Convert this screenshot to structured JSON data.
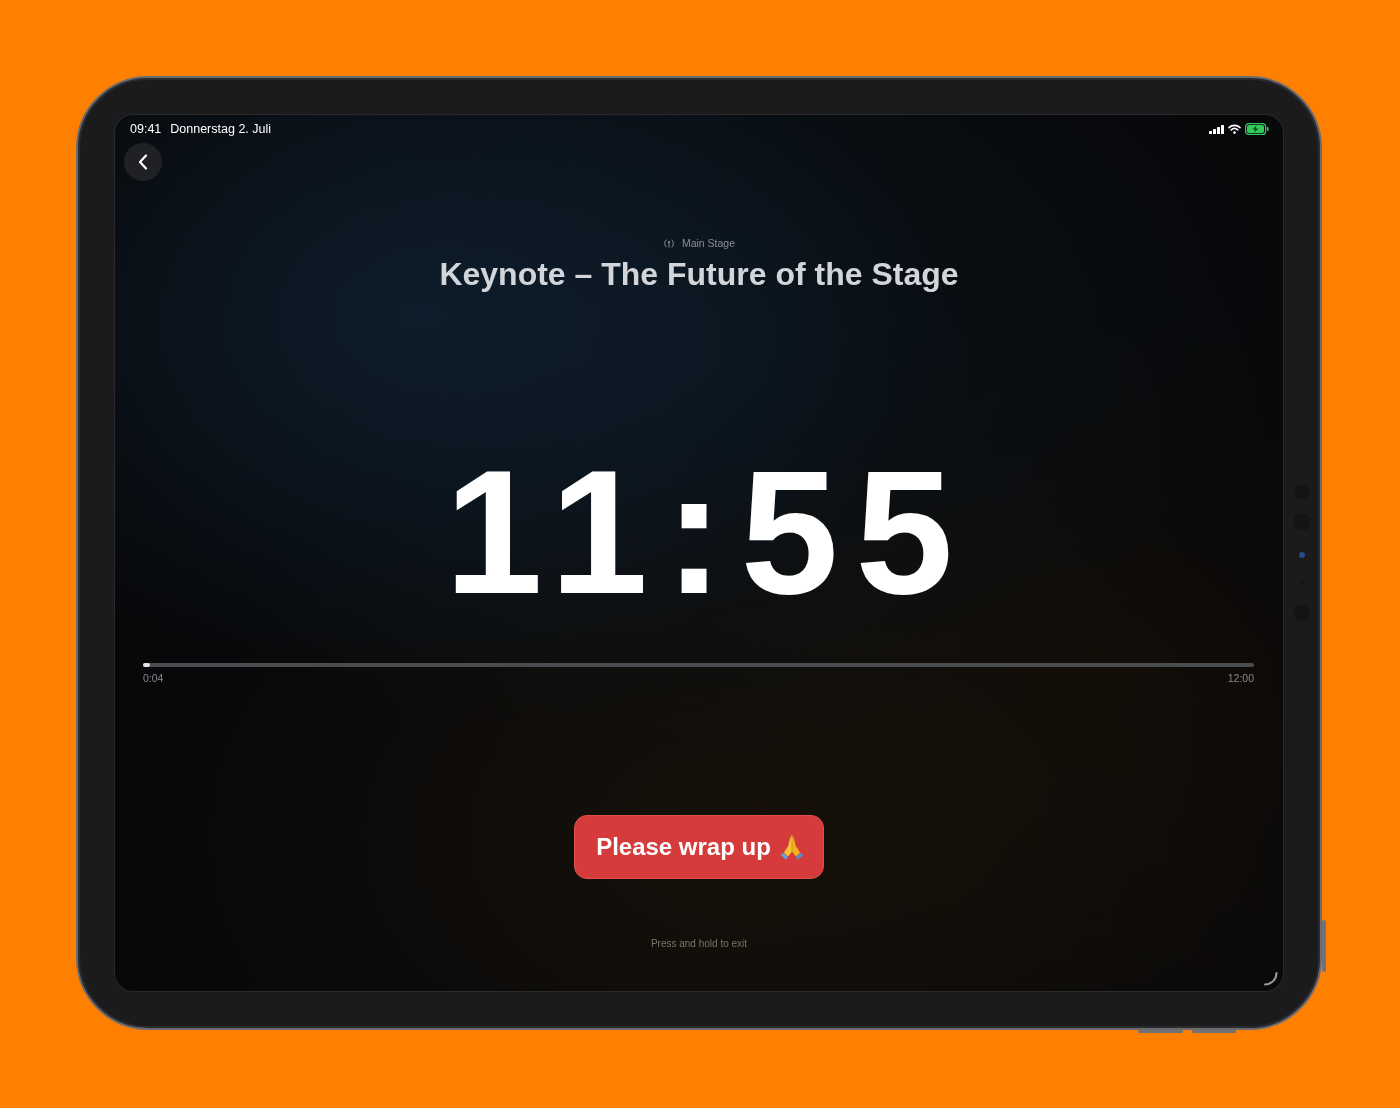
{
  "status_bar": {
    "time": "09:41",
    "date": "Donnerstag 2. Juli",
    "battery_charging": true
  },
  "header": {
    "venue": "Main Stage",
    "title": "Keynote – The Future of the Stage"
  },
  "timer": {
    "display": "11:55"
  },
  "progress": {
    "level": 0.006,
    "elapsed": "0:04",
    "total": "12:00"
  },
  "message_button": {
    "label": "Please wrap up"
  },
  "hint": "Press and hold to exit"
}
